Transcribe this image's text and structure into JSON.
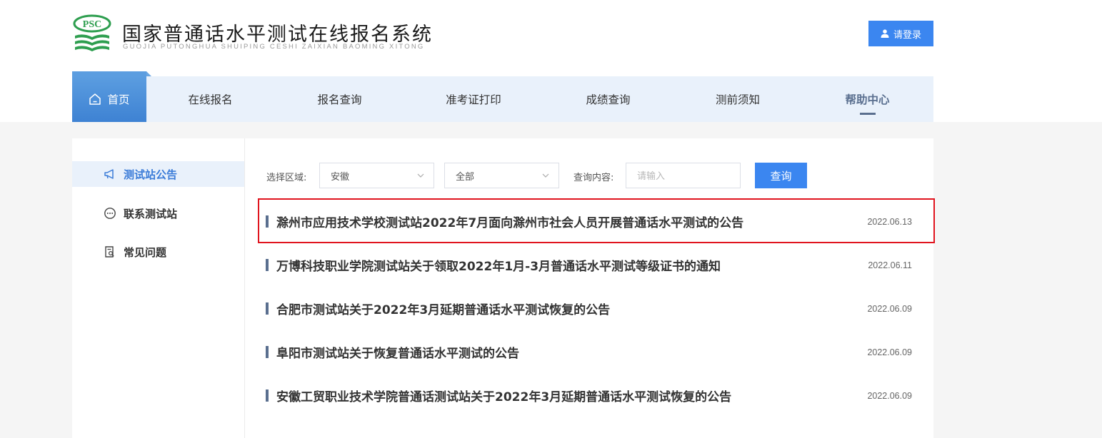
{
  "header": {
    "logo_mark_text": "PSC",
    "title": "国家普通话水平测试在线报名系统",
    "subtitle": "GUOJIA PUTONGHUA SHUIPING CESHI ZAIXIAN BAOMING XITONG",
    "login_label": "请登录"
  },
  "nav": {
    "items": [
      {
        "label": "首页",
        "icon": "home-icon",
        "active": true
      },
      {
        "label": "在线报名"
      },
      {
        "label": "报名查询"
      },
      {
        "label": "准考证打印"
      },
      {
        "label": "成绩查询"
      },
      {
        "label": "测前须知"
      },
      {
        "label": "帮助中心",
        "current": true
      }
    ]
  },
  "sidebar": {
    "items": [
      {
        "label": "测试站公告",
        "icon": "megaphone-icon",
        "active": true
      },
      {
        "label": "联系测试站",
        "icon": "chat-bubble-icon"
      },
      {
        "label": "常见问题",
        "icon": "document-search-icon"
      }
    ]
  },
  "filters": {
    "region_label": "选择区域:",
    "province_value": "安徽",
    "city_value": "全部",
    "query_label": "查询内容:",
    "query_placeholder": "请输入",
    "query_value": "",
    "search_label": "查询"
  },
  "notices": [
    {
      "title": "滁州市应用技术学校测试站2022年7月面向滁州市社会人员开展普通话水平测试的公告",
      "date": "2022.06.13",
      "highlighted": true
    },
    {
      "title": "万博科技职业学院测试站关于领取2022年1月-3月普通话水平测试等级证书的通知",
      "date": "2022.06.11"
    },
    {
      "title": "合肥市测试站关于2022年3月延期普通话水平测试恢复的公告",
      "date": "2022.06.09"
    },
    {
      "title": "阜阳市测试站关于恢复普通话水平测试的公告",
      "date": "2022.06.09"
    },
    {
      "title": "安徽工贸职业技术学院普通话测试站关于2022年3月延期普通话水平测试恢复的公告",
      "date": "2022.06.09"
    }
  ],
  "colors": {
    "accent": "#3b86f0",
    "nav_bg": "#e9f1fb",
    "active_tab": "#4a8fd9",
    "logo_green": "#2e9e4f",
    "highlight_red": "#e0141e",
    "bar_slate": "#5a6f8f"
  }
}
